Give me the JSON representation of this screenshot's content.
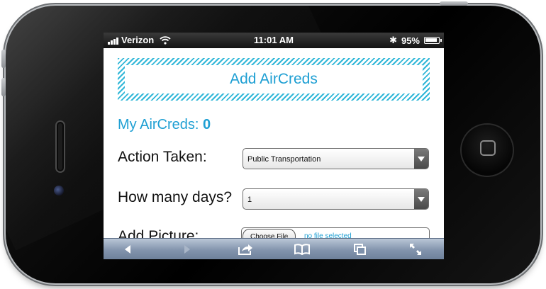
{
  "statusbar": {
    "carrier": "Verizon",
    "time": "11:01 AM",
    "battery_percent_text": "95%",
    "battery_level": 0.95
  },
  "page": {
    "title": "Add AirCreds",
    "credits_label": "My AirCreds:",
    "credits_value": "0",
    "action_label": "Action Taken:",
    "action_value": "Public Transportation",
    "days_label": "How many days?",
    "days_value": "1",
    "picture_label": "Add Picture:",
    "choose_file_label": "Choose File",
    "file_status": "no file selected"
  },
  "toolbar": {
    "icons": [
      "back-icon",
      "forward-icon",
      "share-icon",
      "bookmarks-icon",
      "pages-icon",
      "fullscreen-icon"
    ]
  },
  "colors": {
    "accent": "#1e9fd3",
    "stripe": "#31b7d8",
    "toolbar": "#8394ad"
  }
}
